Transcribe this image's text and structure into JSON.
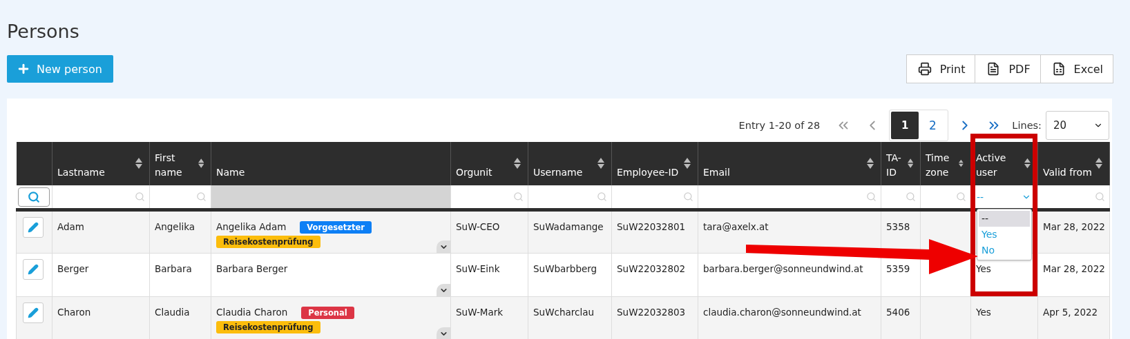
{
  "page": {
    "title": "Persons"
  },
  "new_button": {
    "label": "New person"
  },
  "exports": [
    {
      "label": "Print",
      "kind": "print"
    },
    {
      "label": "PDF",
      "kind": "pdf"
    },
    {
      "label": "Excel",
      "kind": "excel"
    }
  ],
  "pagination": {
    "summary": "Entry 1-20 of 28",
    "pages": [
      {
        "label": "1",
        "selected": true
      },
      {
        "label": "2",
        "selected": false
      }
    ],
    "lines_label": "Lines:",
    "lines_value": "20"
  },
  "table": {
    "columns": [
      {
        "label": "Lastname",
        "kind": "text"
      },
      {
        "label": "First name",
        "kind": "text"
      },
      {
        "label": "Name",
        "kind": "disabled"
      },
      {
        "label": "Orgunit",
        "kind": "text"
      },
      {
        "label": "Username",
        "kind": "text"
      },
      {
        "label": "Employee-ID",
        "kind": "text"
      },
      {
        "label": "Email",
        "kind": "text"
      },
      {
        "label": "TA-ID",
        "kind": "text"
      },
      {
        "label": "Time zone",
        "kind": "text"
      },
      {
        "label": "Active user",
        "kind": "select"
      },
      {
        "label": "Valid from",
        "kind": "text"
      }
    ],
    "rows": [
      {
        "lastname": "Adam",
        "firstname": "Angelika",
        "name": "Angelika Adam",
        "tags": [
          {
            "label": "Vorgesetzter",
            "color": "#0d7ff5"
          },
          {
            "label": "Reisekostenprüfung",
            "color": "#fcbd0c"
          }
        ],
        "orgunit": "SuW-CEO",
        "username": "SuWadamange",
        "employee_id": "SuW22032801",
        "email": "tara@axelx.at",
        "ta_id": "5358",
        "valid_from": "Mar 28, 2022"
      },
      {
        "lastname": "Berger",
        "firstname": "Barbara",
        "name": "Barbara Berger",
        "orgunit": "SuW-Eink",
        "username": "SuWbarbberg",
        "employee_id": "SuW22032802",
        "email": "barbara.berger@sonneundwind.at",
        "ta_id": "5359",
        "active": "Yes",
        "valid_from": "Mar 28, 2022"
      },
      {
        "lastname": "Charon",
        "firstname": "Claudia",
        "name": "Claudia Charon",
        "tags": [
          {
            "label": "Personal",
            "color": "#dc3545"
          },
          {
            "label": "Reisekostenprüfung",
            "color": "#fcbd0c"
          }
        ],
        "orgunit": "SuW-Mark",
        "username": "SuWcharclau",
        "employee_id": "SuW22032803",
        "email": "claudia.charon@sonneundwind.at",
        "ta_id": "5406",
        "active": "Yes",
        "valid_from": "Apr 5, 2022"
      }
    ]
  },
  "active_filter": {
    "value": "--",
    "expanded": true,
    "options": [
      {
        "label": "--",
        "selected": true
      },
      {
        "label": "Yes",
        "selected": false
      },
      {
        "label": "No",
        "selected": false
      }
    ]
  }
}
